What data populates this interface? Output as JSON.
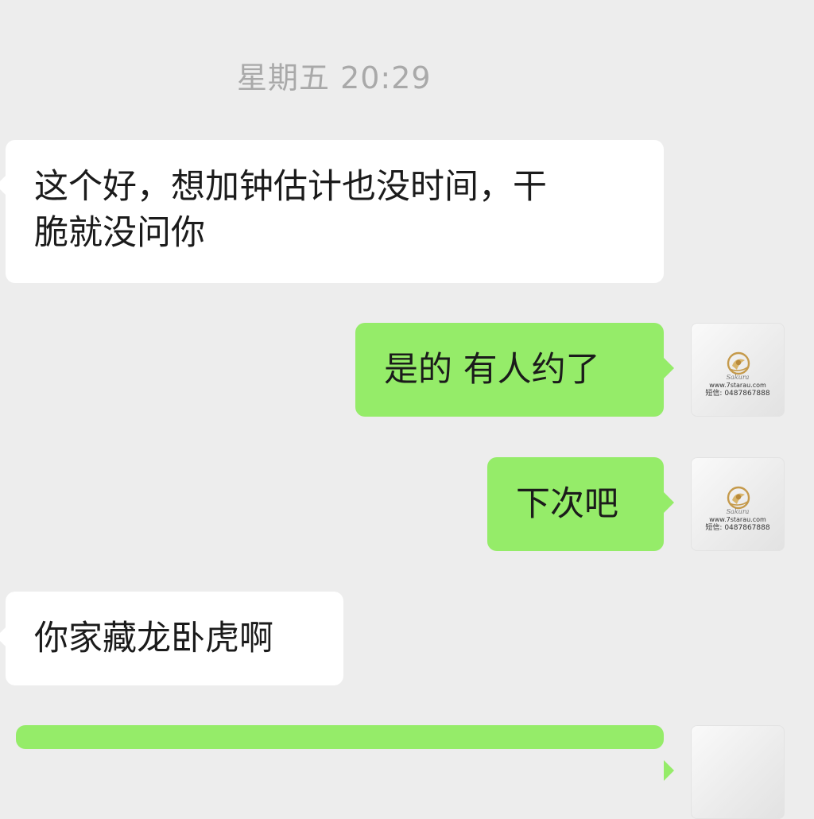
{
  "chat": {
    "timestamp": "星期五 20:29",
    "messages": [
      {
        "direction": "incoming",
        "text": "这个好，想加钟估计也没时间，干",
        "text_line2": "脆就没问你"
      },
      {
        "direction": "outgoing",
        "text": "是的 有人约了"
      },
      {
        "direction": "outgoing",
        "text": "下次吧"
      },
      {
        "direction": "incoming",
        "text": "你家藏龙卧虎啊"
      },
      {
        "direction": "outgoing",
        "text": ""
      }
    ]
  },
  "self_avatar": {
    "script": "Sakura",
    "url": "www.7starau.com",
    "phone": "短信: 0487867888"
  },
  "colors": {
    "background": "#ededed",
    "incoming_bubble": "#ffffff",
    "outgoing_bubble": "#95ec69",
    "timestamp": "#a9a9a9",
    "logo_gold": "#c59a4b"
  },
  "icons": [
    "sakura-logo-icon"
  ]
}
